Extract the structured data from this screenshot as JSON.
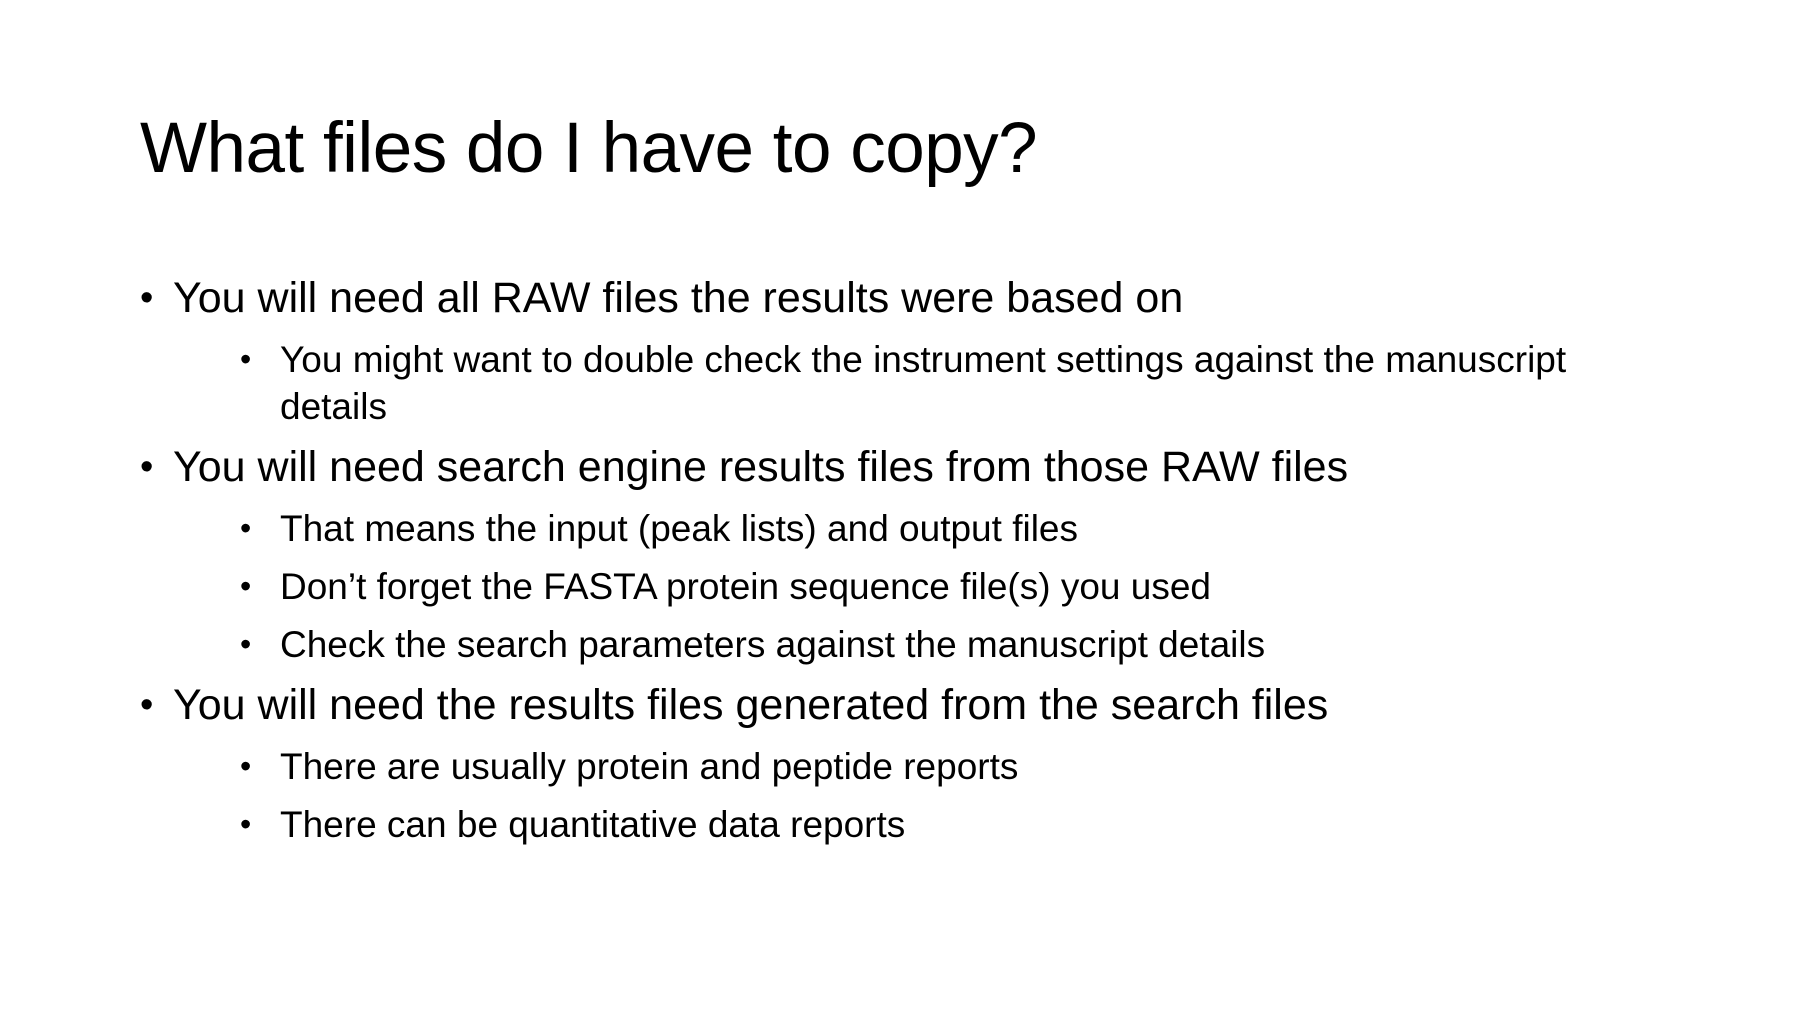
{
  "slide": {
    "title": "What files do I have to copy?",
    "bullet_glyph": "•",
    "items": [
      {
        "text": "You will need all RAW files the results were based on",
        "sub": [
          "You might want to double check the instrument settings against the manuscript details"
        ]
      },
      {
        "text": "You will need search engine results files from those RAW files",
        "sub": [
          "That means the input (peak lists) and output files",
          "Don’t forget the FASTA protein sequence file(s) you used",
          "Check the search parameters against the manuscript details"
        ]
      },
      {
        "text": "You will need the results files generated from the search files",
        "sub": [
          "There are usually protein and peptide reports",
          "There can be quantitative data reports"
        ]
      }
    ]
  }
}
